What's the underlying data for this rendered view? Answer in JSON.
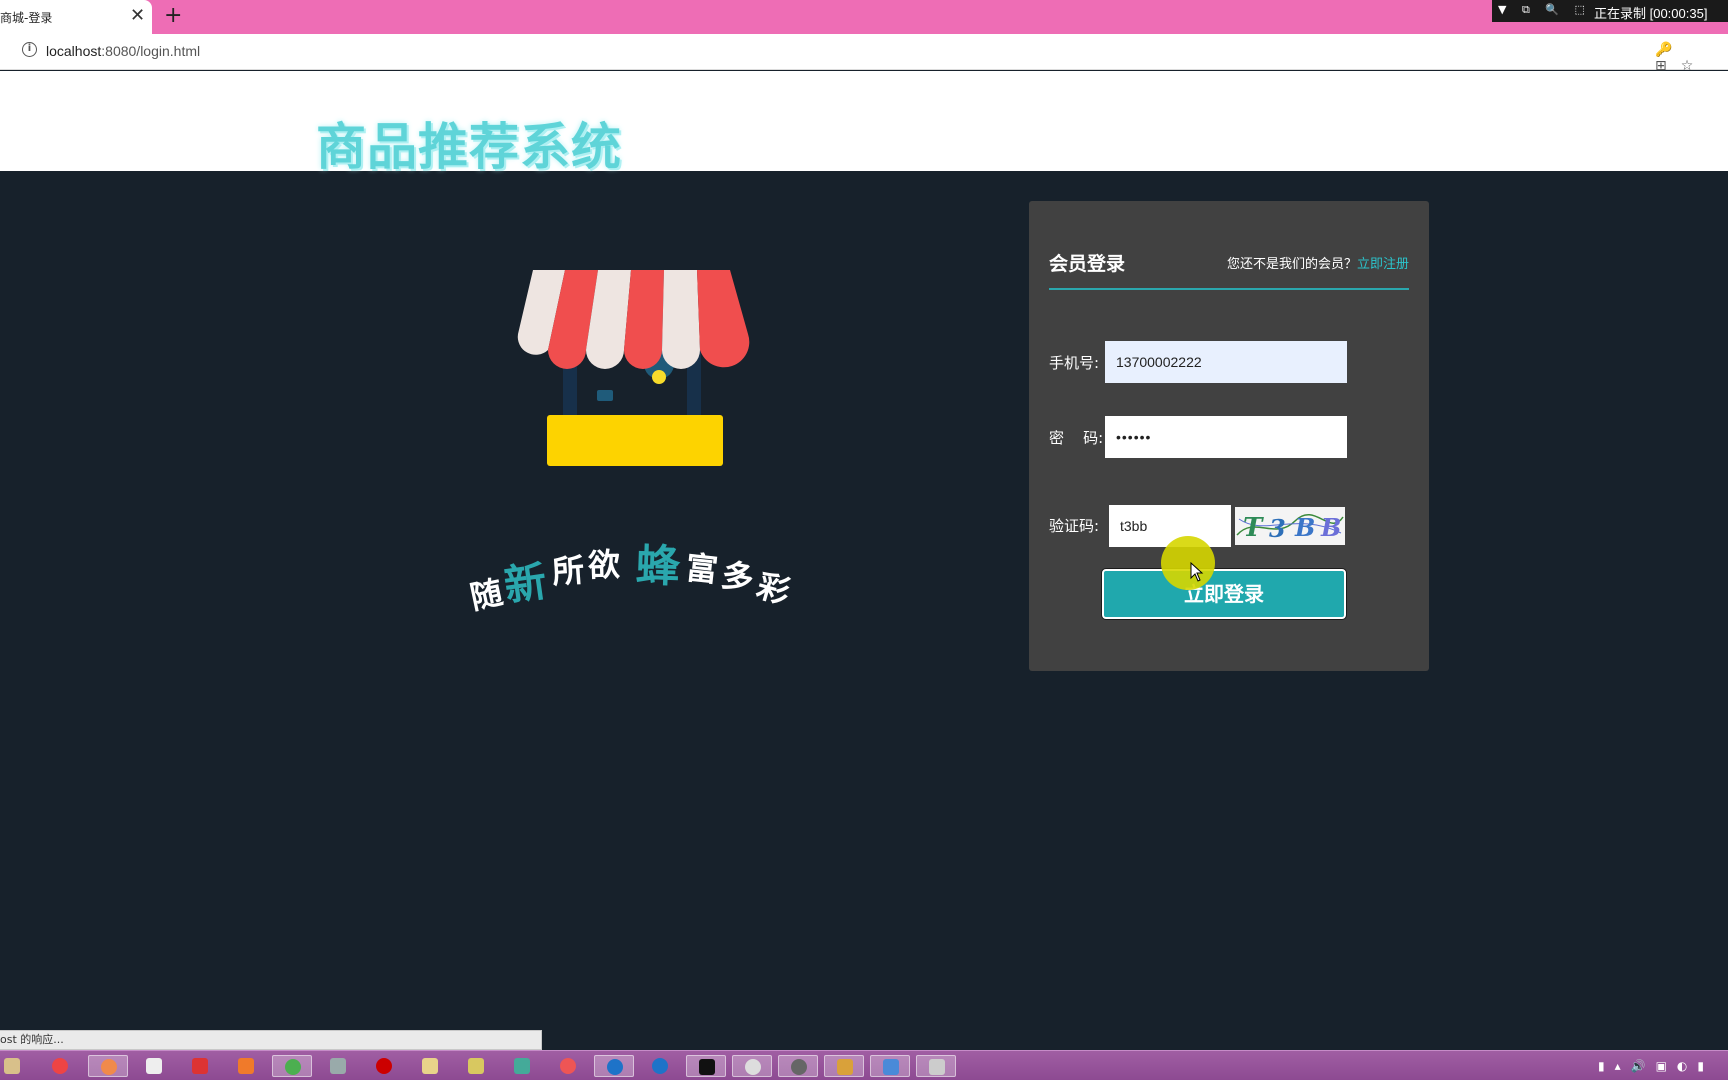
{
  "browser": {
    "tab_title": "商城-登录",
    "tab_close": "✕",
    "new_tab": "+",
    "url_host": "localhost",
    "url_rest": ":8080/login.html",
    "info_icon": "i",
    "right_icons": "🔑⊞☆",
    "recorder_icons": "▼ ⧉ 🔍 ⬚",
    "recorder_text": "正在录制 [00:00:35]"
  },
  "site": {
    "title": "商品推荐系统"
  },
  "slogan": {
    "chars": [
      "随",
      "新",
      "所",
      "欲",
      "蜂",
      "富",
      "多",
      "彩"
    ]
  },
  "login": {
    "title": "会员登录",
    "hint": "您还不是我们的会员？",
    "register_link": "立即注册",
    "phone_label": "手机号:",
    "phone_value": "13700002222",
    "password_label": "密    码:",
    "password_value": "••••••",
    "code_label": "验证码:",
    "code_value": "t3bb",
    "captcha_text": "T3BB",
    "submit_label": "立即登录"
  },
  "status": {
    "text": "ost 的响应..."
  },
  "colors": {
    "accent": "#20a8ad",
    "page_bg": "#17212b",
    "panel_bg": "#414141",
    "title_color": "#5fd4d8",
    "tabstrip": "#ee6db5",
    "taskbar": "#9a58a0"
  }
}
